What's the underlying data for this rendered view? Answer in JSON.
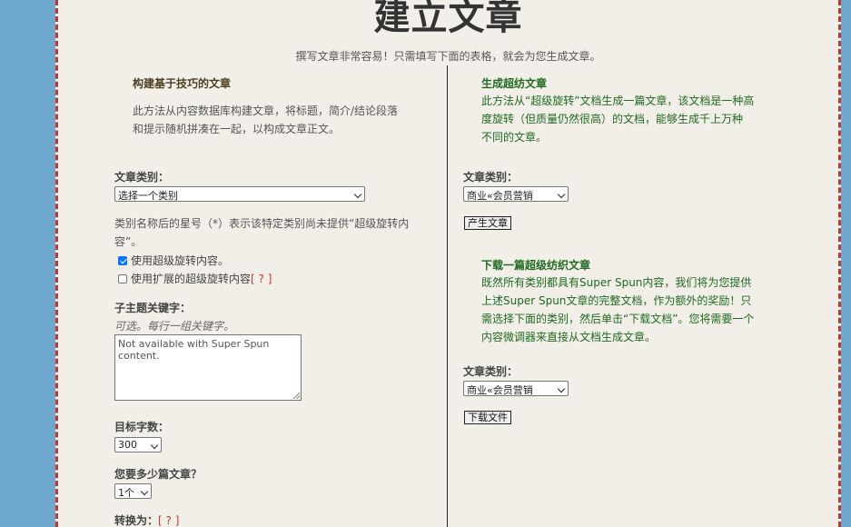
{
  "page": {
    "title": "建立文章",
    "subtitle": "撰写文章非常容易！只需填写下面的表格，就会为您生成文章。"
  },
  "left": {
    "heading": "构建基于技巧的文章",
    "description_lines": [
      "此方法从内容数据库构建文章，将标题，简介/结论段落",
      "和提示随机拼凑在一起，以构成文章正文。"
    ],
    "category_label": "文章类别：",
    "category_value": "选择一个类别",
    "asterisk_note_lines": [
      "类别名称后的星号（*）表示该特定类别尚未提供“超级旋转内",
      "容”。"
    ],
    "checkbox_superspun": {
      "label": "使用超级旋转内容。",
      "checked": true
    },
    "checkbox_extended": {
      "label": "使用扩展的超级旋转内容",
      "help": "[ ? ]",
      "checked": false
    },
    "subtopic_label": "子主题关键字：",
    "subtopic_hint": "可选。每行一组关键字。",
    "subtopic_value": "Not available with Super Spun content.",
    "wordcount_label": "目标字数：",
    "wordcount_value": "300",
    "count_label": "您要多少篇文章？",
    "count_value": "1个",
    "convert_label": "转换为：",
    "convert_help": "[ ? ]"
  },
  "right": {
    "spin_heading": "生成超纺文章",
    "spin_description_lines": [
      "此方法从“超级旋转”文档生成一篇文章，该文档是一种高",
      "度旋转（但质量仍然很高）的文档，能够生成千上万种",
      "不同的文章。"
    ],
    "spin_category_label": "文章类别：",
    "spin_category_value": "商业«会员营销",
    "generate_button": "产生文章",
    "download_heading": "下载一篇超级纺织文章",
    "download_description_lines": [
      "既然所有类别都具有Super Spun内容，我们将为您提供",
      "上述Super Spun文章的完整文档，作为额外的奖励！只",
      "需选择下面的类别，然后单击“下载文档”。您将需要一个",
      "内容微调器来直接从文档生成文章。"
    ],
    "download_category_label": "文章类别：",
    "download_category_value": "商业«会员营销",
    "download_button": "下载文件"
  }
}
